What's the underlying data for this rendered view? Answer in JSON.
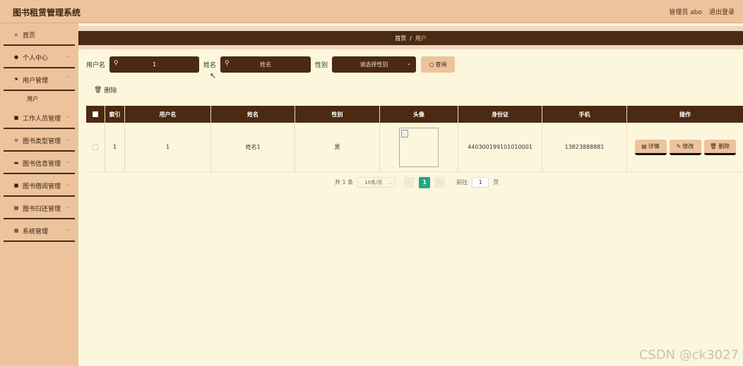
{
  "app": {
    "title": "图书租赁管理系统"
  },
  "header": {
    "user_label": "管理员 abo",
    "logout_label": "退出登录"
  },
  "sidebar": {
    "items": [
      {
        "label": "首页",
        "icon": "home-icon",
        "glyph": "⌂",
        "expandable": false
      },
      {
        "label": "个人中心",
        "icon": "user-icon",
        "glyph": "●",
        "expandable": true
      },
      {
        "label": "用户管理",
        "icon": "flag-icon",
        "glyph": "⚑",
        "expandable": true,
        "children": [
          "用户"
        ]
      },
      {
        "label": "工作人员管理",
        "icon": "edit-square-icon",
        "glyph": "■",
        "expandable": true
      },
      {
        "label": "图书类型管理",
        "icon": "list-icon",
        "glyph": "≡",
        "expandable": true
      },
      {
        "label": "图书信息管理",
        "icon": "message-icon",
        "glyph": "▬",
        "expandable": true
      },
      {
        "label": "图书借阅管理",
        "icon": "delete-box-icon",
        "glyph": "■",
        "expandable": true
      },
      {
        "label": "图书归还管理",
        "icon": "grid-icon",
        "glyph": "▦",
        "expandable": true
      },
      {
        "label": "系统管理",
        "icon": "apps-icon",
        "glyph": "▦",
        "expandable": true
      }
    ]
  },
  "breadcrumb": {
    "home": "首页",
    "separator": "/",
    "current": "用户"
  },
  "search": {
    "username_label": "用户名",
    "username_value": "1",
    "name_label": "姓名",
    "name_placeholder": "姓名",
    "gender_label": "性别",
    "gender_placeholder": "请选择性别",
    "query_label": "查询"
  },
  "actions": {
    "delete_label": "删除"
  },
  "table": {
    "columns": [
      "索引",
      "用户名",
      "姓名",
      "性别",
      "头像",
      "身份证",
      "手机",
      "操作"
    ],
    "rows": [
      {
        "index": "1",
        "username": "1",
        "name": "姓名1",
        "gender": "男",
        "idcard": "440300199101010001",
        "phone": "13823888881"
      }
    ],
    "row_actions": {
      "detail": "详情",
      "edit": "修改",
      "delete": "删除"
    }
  },
  "pagination": {
    "total_text": "共 1 条",
    "page_size": "10条/页",
    "current_page": "1",
    "goto_label": "前往",
    "goto_value": "1",
    "page_suffix": "页"
  },
  "watermark": "CSDN @ck3027",
  "colors": {
    "sidebar": "#ecc39c",
    "dark": "#4a2a12",
    "background": "#fcf6dd",
    "accent": "#1ea88a"
  }
}
